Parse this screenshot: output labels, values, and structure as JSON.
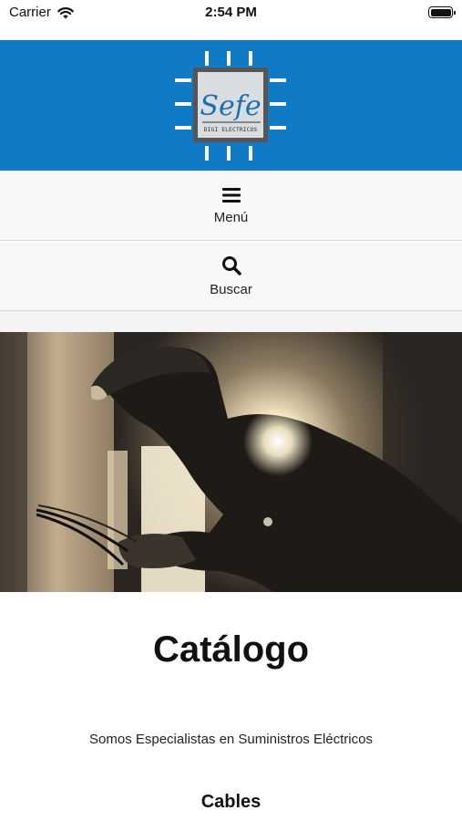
{
  "status_bar": {
    "carrier": "Carrier",
    "time": "2:54 PM"
  },
  "header": {
    "logo_text": "Sefe",
    "logo_subtext": "DIGI ELECTRICOS",
    "brand_color": "#0f7ac5"
  },
  "nav": {
    "menu_label": "Menú",
    "search_label": "Buscar"
  },
  "content": {
    "title": "Catálogo",
    "subtitle": "Somos Especialistas en Suministros Eléctricos",
    "section_heading": "Cables"
  }
}
